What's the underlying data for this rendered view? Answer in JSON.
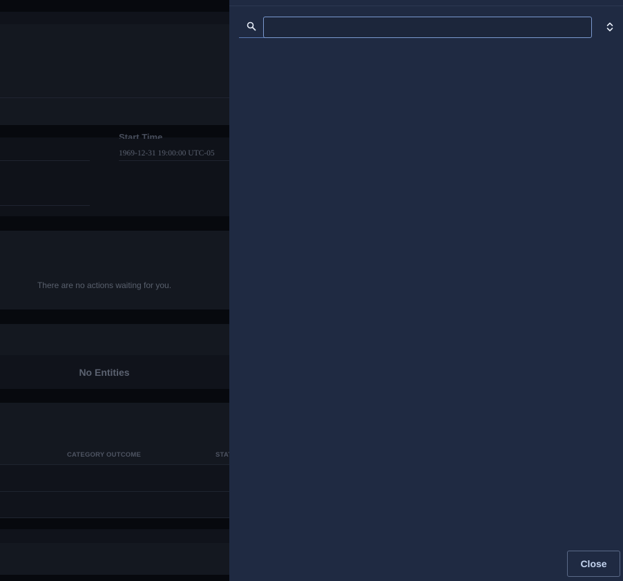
{
  "background": {
    "start_time_label": "Start Time",
    "start_time_value": "1969-12-31 19:00:00 UTC-05",
    "actions_empty": "There are no actions waiting for you.",
    "entities_empty": "No Entities",
    "columns": [
      "CATEGORY OUTCOME",
      "STAT"
    ]
  },
  "panel": {
    "search": {
      "value": "",
      "placeholder": ""
    },
    "close_label": "Close"
  },
  "colors": {
    "panel_bg": "#1f2a42",
    "accent": "#7b9ad0",
    "page_bg": "#0b0d14"
  }
}
